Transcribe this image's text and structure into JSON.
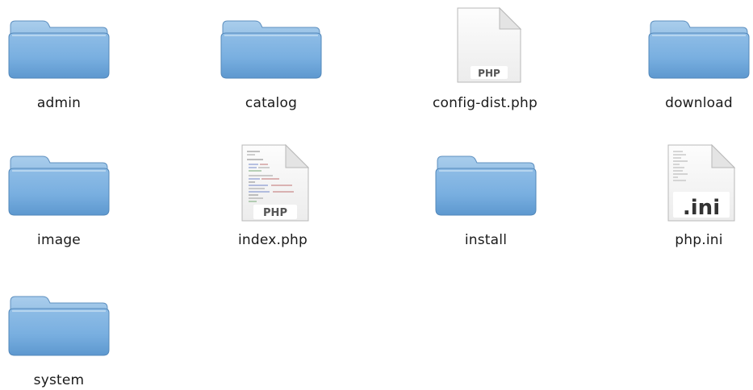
{
  "finder": {
    "items": [
      {
        "name": "admin",
        "kind": "folder",
        "icon": "folder-icon"
      },
      {
        "name": "catalog",
        "kind": "folder",
        "icon": "folder-icon"
      },
      {
        "name": "config-dist.php",
        "kind": "php-file",
        "icon": "php-file-icon",
        "badge": "PHP"
      },
      {
        "name": "download",
        "kind": "folder",
        "icon": "folder-icon"
      },
      {
        "name": "image",
        "kind": "folder",
        "icon": "folder-icon"
      },
      {
        "name": "index.php",
        "kind": "php-file-preview",
        "icon": "php-file-icon",
        "badge": "PHP"
      },
      {
        "name": "install",
        "kind": "folder",
        "icon": "folder-icon"
      },
      {
        "name": "php.ini",
        "kind": "ini-file",
        "icon": "ini-file-icon",
        "badge": ".ini"
      },
      {
        "name": "system",
        "kind": "folder",
        "icon": "folder-icon"
      }
    ]
  },
  "colors": {
    "folder_body": "#7fb1dc",
    "folder_back": "#9cc3e6",
    "folder_dark": "#5f94c4",
    "label_text": "#1a1a1a"
  }
}
